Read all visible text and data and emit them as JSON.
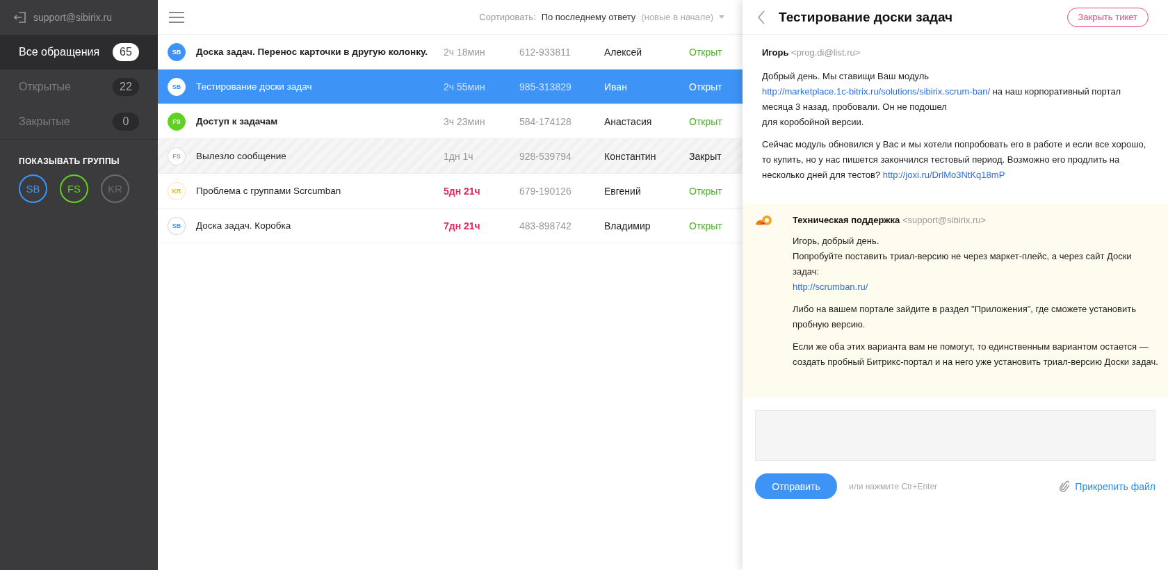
{
  "account": {
    "email": "support@sibirix.ru"
  },
  "nav": [
    {
      "label": "Все обращения",
      "count": "65",
      "selected": true
    },
    {
      "label": "Открытые",
      "count": "22",
      "selected": false
    },
    {
      "label": "Закрытые",
      "count": "0",
      "selected": false
    }
  ],
  "groups": {
    "title": "ПОКАЗЫВАТЬ ГРУППЫ",
    "items": [
      {
        "label": "SB",
        "color": "#3d94f6"
      },
      {
        "label": "FS",
        "color": "#5fd11f"
      },
      {
        "label": "KR",
        "color": "#6a6a6c"
      }
    ]
  },
  "sort": {
    "label": "Сортировать:",
    "value": "По последнему ответу",
    "hint": "(новые в начале)"
  },
  "tickets": [
    {
      "group": "SB",
      "color": "#3d94f6",
      "title": "Доска задач. Перенос карточки в другую колонку.",
      "age": "2ч 18мин",
      "phone": "612-933811",
      "client": "Алексей",
      "status": "Открыт",
      "unread": true,
      "selected": false,
      "closed": false,
      "overdue": false
    },
    {
      "group": "SB",
      "color": "#3d94f6",
      "title": "Тестирование доски задач",
      "age": "2ч 55мин",
      "phone": "985-313829",
      "client": "Иван",
      "status": "Открыт",
      "unread": false,
      "selected": true,
      "closed": false,
      "overdue": false
    },
    {
      "group": "FS",
      "color": "#5fd11f",
      "title": "Доступ к задачам",
      "age": "3ч 23мин",
      "phone": "584-174128",
      "client": "Анастасия",
      "status": "Открыт",
      "unread": true,
      "selected": false,
      "closed": false,
      "overdue": false
    },
    {
      "group": "FS",
      "color": "#9a9a9a",
      "title": "Вылезло сообщение",
      "age": "1дн 1ч",
      "phone": "928-539794",
      "client": "Константин",
      "status": "Закрыт",
      "unread": false,
      "selected": false,
      "closed": true,
      "overdue": false
    },
    {
      "group": "KR",
      "color": "#f2b51c",
      "title": "Проблема с группами Scrcumban",
      "age": "5дн 21ч",
      "phone": "679-190126",
      "client": "Евгений",
      "status": "Открыт",
      "unread": false,
      "selected": false,
      "closed": false,
      "overdue": true
    },
    {
      "group": "SB",
      "color": "#3d94f6",
      "title": "Доска задач. Коробка",
      "age": "7дн 21ч",
      "phone": "483-898742",
      "client": "Владимир",
      "status": "Открыт",
      "unread": false,
      "selected": false,
      "closed": false,
      "overdue": true
    }
  ],
  "detail": {
    "title": "Тестирование доски задач",
    "close_button": "Закрыть тикет",
    "messages": [
      {
        "kind": "client",
        "author": "Игорь",
        "email": "<prog.di@list.ru>",
        "paragraphs": [
          [
            {
              "kind": "text",
              "text": "Добрый день. Мы ставищи Ваш модуль "
            },
            {
              "kind": "link",
              "text": "http://marketplace.1c-bitrix.ru/solutions/sibirix.scrum-ban/"
            },
            {
              "kind": "text",
              "text": " на наш корпоративный портал месяца 3 назад, пробовали. Он не подошел"
            },
            {
              "kind": "break"
            },
            {
              "kind": "text",
              "text": "для коробойной версии."
            }
          ],
          [
            {
              "kind": "text",
              "text": "Сейчас модуль обновился у Вас и мы хотели попробовать его в работе и если все хорошо, то купить, но у нас пишется закончился тестовый период. Возможно его продлить на несколько дней для тестов? "
            },
            {
              "kind": "link",
              "text": "http://joxi.ru/DrlMo3NtKq18mP"
            }
          ]
        ]
      },
      {
        "kind": "support",
        "author": "Техническая поддержка",
        "email": "<support@sibirix.ru>",
        "paragraphs": [
          [
            {
              "kind": "text",
              "text": "Игорь, добрый день."
            },
            {
              "kind": "break"
            },
            {
              "kind": "text",
              "text": "Попробуйте поставить триал-версию не через маркет-плейс, а через сайт Доски задач:"
            },
            {
              "kind": "break"
            },
            {
              "kind": "link",
              "text": "http://scrumban.ru/"
            }
          ],
          [
            {
              "kind": "text",
              "text": "Либо на вашем портале зайдите в раздел \"Приложения\", где сможете установить пробную версию."
            }
          ],
          [
            {
              "kind": "text",
              "text": "Если же оба этих варианта вам не помогут, то единственным вариантом остается — создать пробный Битрикс-портал и на него уже установить триал-версию Доски задач."
            }
          ]
        ]
      }
    ],
    "reply": {
      "send_button": "Отправить",
      "hint": "или нажмите Ctr+Enter",
      "attach": "Прикрепить файл"
    }
  }
}
